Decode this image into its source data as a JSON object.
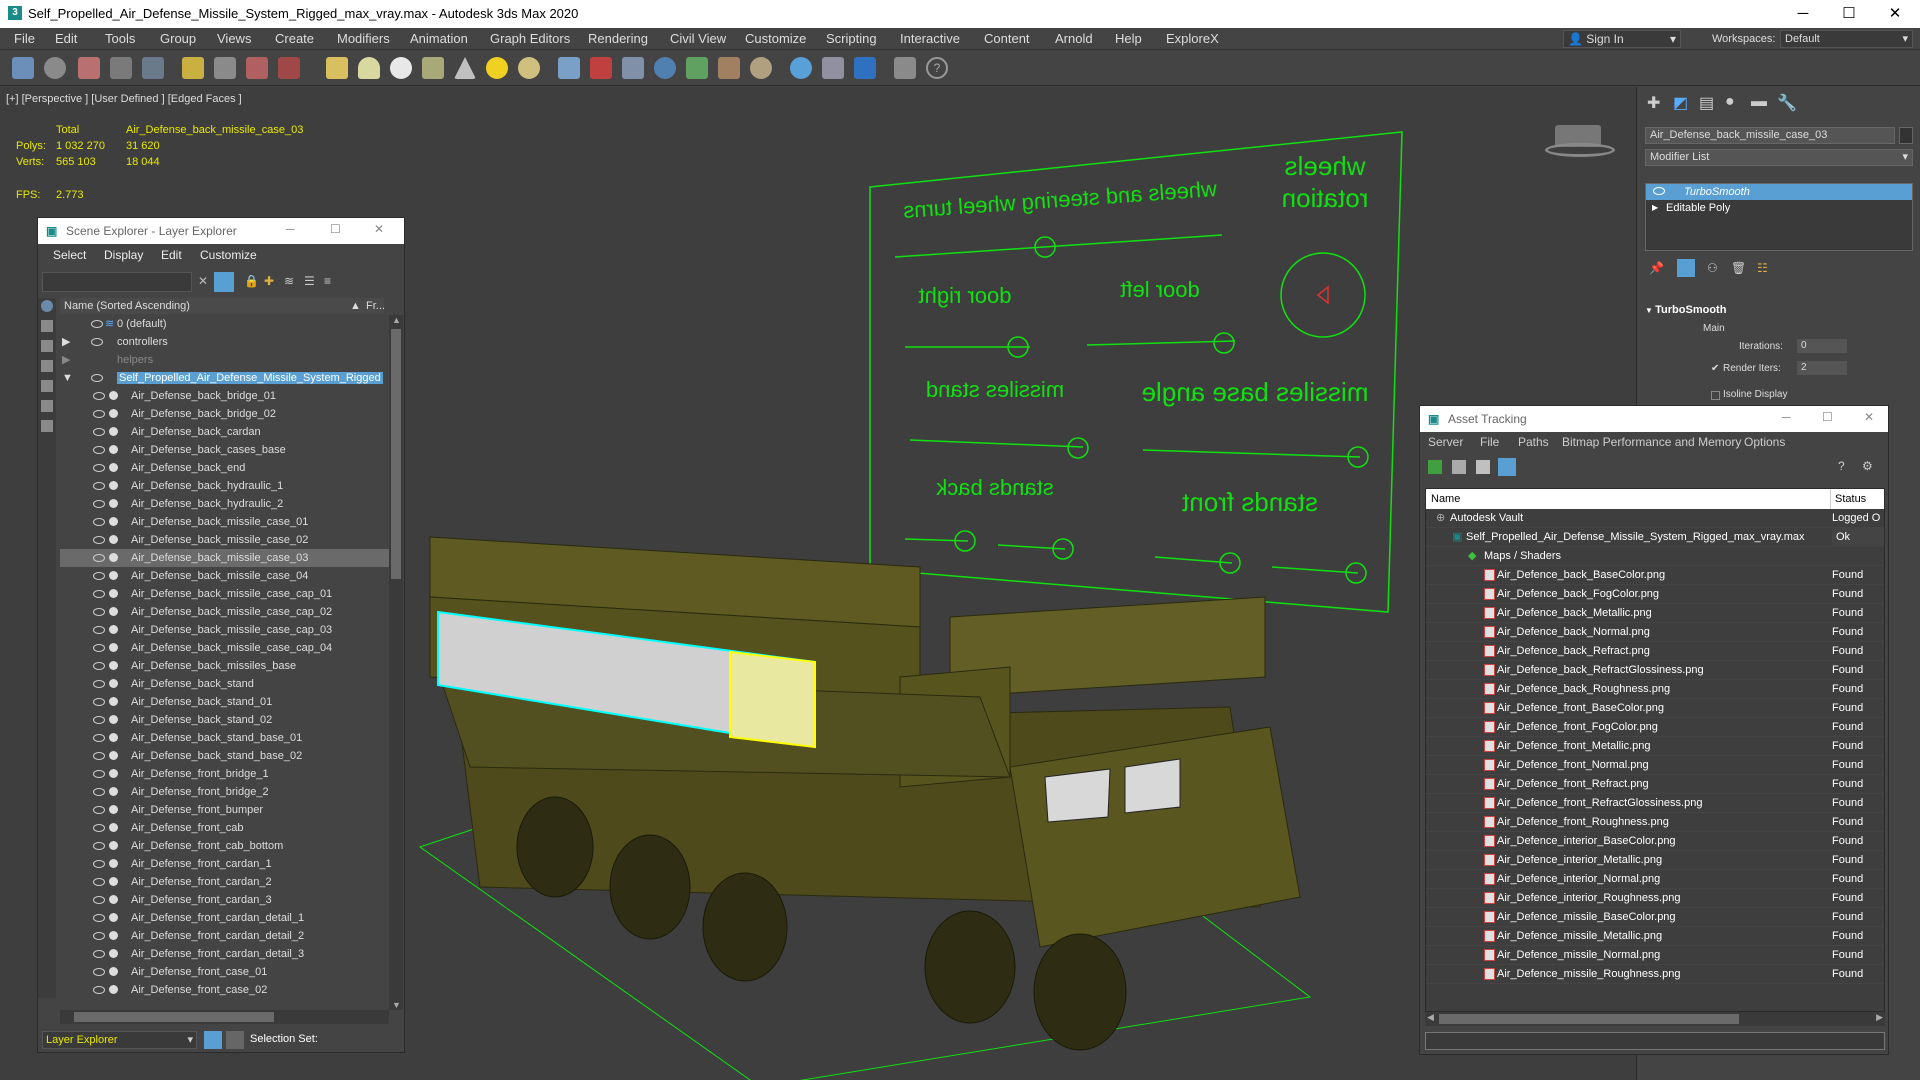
{
  "window": {
    "title": "Self_Propelled_Air_Defense_Missile_System_Rigged_max_vray.max - Autodesk 3ds Max 2020",
    "app_icon": "3",
    "minimize": "─",
    "maximize": "☐",
    "close": "✕"
  },
  "menu": [
    "File",
    "Edit",
    "Tools",
    "Group",
    "Views",
    "Create",
    "Modifiers",
    "Animation",
    "Graph Editors",
    "Rendering",
    "Civil View",
    "Customize",
    "Scripting",
    "Interactive",
    "Content",
    "Arnold",
    "Help",
    "ExploreX"
  ],
  "signin": {
    "label": "Sign In"
  },
  "workspaces": {
    "label": "Workspaces:",
    "value": "Default"
  },
  "viewport": {
    "label": "[+] [Perspective ] [User Defined ] [Edged Faces ]",
    "stats": {
      "col_total": "Total",
      "col_obj": "Air_Defense_back_missile_case_03",
      "polys_label": "Polys:",
      "polys_total": "1 032 270",
      "polys_obj": "31 620",
      "verts_label": "Verts:",
      "verts_total": "565 103",
      "verts_obj": "18 044",
      "fps_label": "FPS:",
      "fps_val": "2.773"
    },
    "panel_labels": {
      "wheels_steering": "wheels and steering wheel turns",
      "wheels_rotation_1": "wheels",
      "wheels_rotation_2": "rotation",
      "door_right": "door right",
      "door_left": "door left",
      "missiles_stand": "missiles stand",
      "missiles_base_angle": "missiles base angle",
      "stands_back": "stands back",
      "stands_front": "stands front"
    }
  },
  "scene_explorer": {
    "title": "Scene Explorer - Layer Explorer",
    "menu": [
      "Select",
      "Display",
      "Edit",
      "Customize"
    ],
    "column": "Name (Sorted Ascending)",
    "column2": "Fr...",
    "layers": [
      {
        "name": "0 (default)",
        "indent": 0
      },
      {
        "name": "controllers",
        "indent": 0
      },
      {
        "name": "helpers",
        "indent": 0
      },
      {
        "name": "Self_Propelled_Air_Defense_Missile_System_Rigged",
        "indent": 0
      }
    ],
    "items": [
      "Air_Defense_back_bridge_01",
      "Air_Defense_back_bridge_02",
      "Air_Defense_back_cardan",
      "Air_Defense_back_cases_base",
      "Air_Defense_back_end",
      "Air_Defense_back_hydraulic_1",
      "Air_Defense_back_hydraulic_2",
      "Air_Defense_back_missile_case_01",
      "Air_Defense_back_missile_case_02",
      "Air_Defense_back_missile_case_03",
      "Air_Defense_back_missile_case_04",
      "Air_Defense_back_missile_case_cap_01",
      "Air_Defense_back_missile_case_cap_02",
      "Air_Defense_back_missile_case_cap_03",
      "Air_Defense_back_missile_case_cap_04",
      "Air_Defense_back_missiles_base",
      "Air_Defense_back_stand",
      "Air_Defense_back_stand_01",
      "Air_Defense_back_stand_02",
      "Air_Defense_back_stand_base_01",
      "Air_Defense_back_stand_base_02",
      "Air_Defense_front_bridge_1",
      "Air_Defense_front_bridge_2",
      "Air_Defense_front_bumper",
      "Air_Defense_front_cab",
      "Air_Defense_front_cab_bottom",
      "Air_Defense_front_cardan_1",
      "Air_Defense_front_cardan_2",
      "Air_Defense_front_cardan_3",
      "Air_Defense_front_cardan_detail_1",
      "Air_Defense_front_cardan_detail_2",
      "Air_Defense_front_cardan_detail_3",
      "Air_Defense_front_case_01",
      "Air_Defense_front_case_02"
    ],
    "selected_index": 9,
    "bottom_dropdown": "Layer Explorer",
    "selection_set": "Selection Set:"
  },
  "right_panel": {
    "object_name": "Air_Defense_back_missile_case_03",
    "modifier_list": "Modifier List",
    "stack": [
      "TurboSmooth",
      "Editable Poly"
    ],
    "rollout_title": "TurboSmooth",
    "main": "Main",
    "iterations_label": "Iterations:",
    "iterations_val": "0",
    "render_iters_label": "Render Iters:",
    "render_iters_val": "2",
    "isoline": "Isoline Display"
  },
  "asset_tracking": {
    "title": "Asset Tracking",
    "menu": [
      "Server",
      "File",
      "Paths",
      "Bitmap Performance and Memory",
      "Options"
    ],
    "col_name": "Name",
    "col_status": "Status",
    "vault": {
      "name": "Autodesk Vault",
      "status": "Logged O"
    },
    "file": {
      "name": "Self_Propelled_Air_Defense_Missile_System_Rigged_max_vray.max",
      "status": "Ok"
    },
    "maps_label": "Maps / Shaders",
    "maps": [
      {
        "name": "Air_Defence_back_BaseColor.png",
        "status": "Found"
      },
      {
        "name": "Air_Defence_back_FogColor.png",
        "status": "Found"
      },
      {
        "name": "Air_Defence_back_Metallic.png",
        "status": "Found"
      },
      {
        "name": "Air_Defence_back_Normal.png",
        "status": "Found"
      },
      {
        "name": "Air_Defence_back_Refract.png",
        "status": "Found"
      },
      {
        "name": "Air_Defence_back_RefractGlossiness.png",
        "status": "Found"
      },
      {
        "name": "Air_Defence_back_Roughness.png",
        "status": "Found"
      },
      {
        "name": "Air_Defence_front_BaseColor.png",
        "status": "Found"
      },
      {
        "name": "Air_Defence_front_FogColor.png",
        "status": "Found"
      },
      {
        "name": "Air_Defence_front_Metallic.png",
        "status": "Found"
      },
      {
        "name": "Air_Defence_front_Normal.png",
        "status": "Found"
      },
      {
        "name": "Air_Defence_front_Refract.png",
        "status": "Found"
      },
      {
        "name": "Air_Defence_front_RefractGlossiness.png",
        "status": "Found"
      },
      {
        "name": "Air_Defence_front_Roughness.png",
        "status": "Found"
      },
      {
        "name": "Air_Defence_interior_BaseColor.png",
        "status": "Found"
      },
      {
        "name": "Air_Defence_interior_Metallic.png",
        "status": "Found"
      },
      {
        "name": "Air_Defence_interior_Normal.png",
        "status": "Found"
      },
      {
        "name": "Air_Defence_interior_Roughness.png",
        "status": "Found"
      },
      {
        "name": "Air_Defence_missile_BaseColor.png",
        "status": "Found"
      },
      {
        "name": "Air_Defence_missile_Metallic.png",
        "status": "Found"
      },
      {
        "name": "Air_Defence_missile_Normal.png",
        "status": "Found"
      },
      {
        "name": "Air_Defence_missile_Roughness.png",
        "status": "Found"
      }
    ]
  },
  "colors": {
    "accent": "#5a9fd4",
    "viewport_bg": "#3e3e3e",
    "stat_yellow": "#e8e800",
    "rig_green": "#10e010",
    "model_olive": "#5e5a22"
  }
}
